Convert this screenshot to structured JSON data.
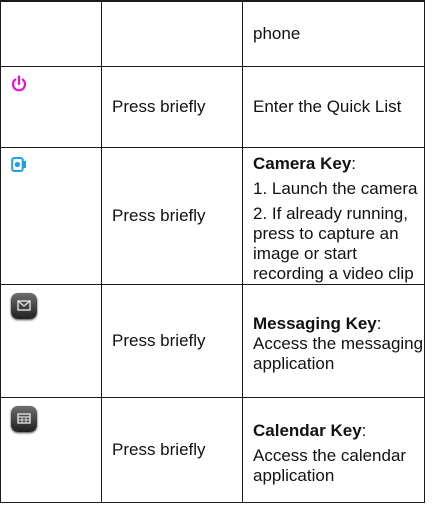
{
  "rows": [
    {
      "icon": "",
      "action": "",
      "desc_lines": [
        {
          "text": "phone",
          "bold": false
        }
      ]
    },
    {
      "icon": "power-icon",
      "action": "Press briefly",
      "desc_lines": [
        {
          "text": "Enter the Quick List",
          "bold": false
        }
      ]
    },
    {
      "icon": "camera-icon",
      "action": "Press briefly",
      "title": "Camera Key",
      "desc_lines": [
        {
          "text": "1. Launch the camera"
        },
        {
          "text": "2. If already running, press to capture an image or start recording a video clip"
        }
      ]
    },
    {
      "icon": "messaging-key-icon",
      "action": "Press briefly",
      "title": "Messaging Key",
      "desc_lines": [
        {
          "text": "Access the messaging application"
        }
      ]
    },
    {
      "icon": "calendar-key-icon",
      "action": "Press briefly",
      "title": "Calendar Key",
      "desc_lines": [
        {
          "text": "Access the calendar application"
        }
      ]
    }
  ],
  "colors": {
    "power": "#e80fd6",
    "camera": "#1da1e6",
    "key_dark": "#1f1f1f"
  }
}
